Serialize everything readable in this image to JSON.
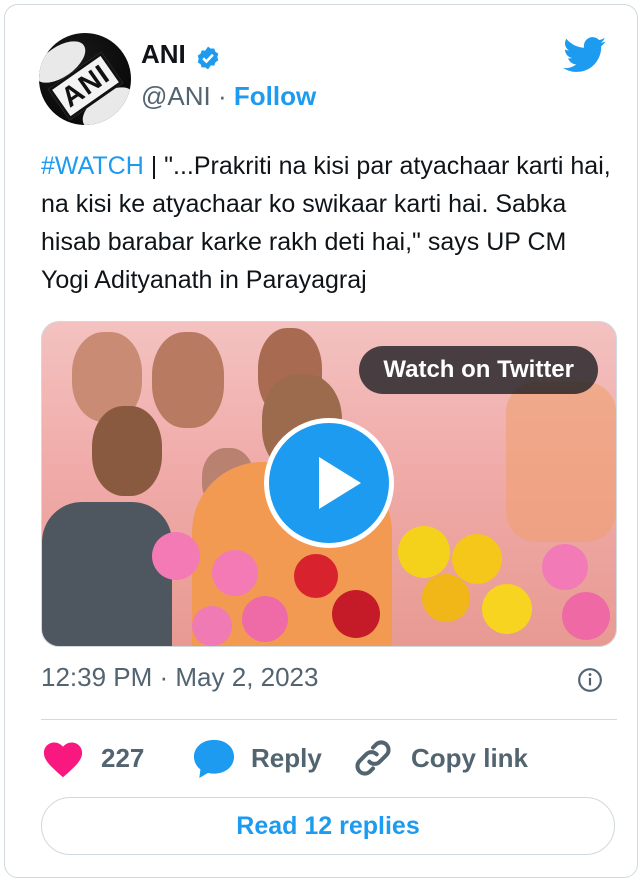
{
  "author": {
    "name": "ANI",
    "handle": "@ANI",
    "separator": "·",
    "follow_label": "Follow",
    "avatar_text": "ANI"
  },
  "tweet": {
    "hashtag": "#WATCH",
    "text": " | \"...Prakriti na kisi par atyachaar karti hai, na kisi ke atyachaar ko swikaar karti hai. Sabka hisab barabar karke rakh deti hai,\" says UP CM Yogi Adityanath in Parayagraj"
  },
  "media": {
    "watch_label": "Watch on Twitter",
    "play_icon": "play-icon"
  },
  "meta": {
    "timestamp": "12:39 PM · May 2, 2023"
  },
  "actions": {
    "like_count": "227",
    "reply_label": "Reply",
    "copy_label": "Copy link"
  },
  "footer": {
    "read_replies_label": "Read 12 replies"
  },
  "colors": {
    "accent": "#1d9bf0",
    "heart": "#f91880",
    "muted": "#536471"
  }
}
